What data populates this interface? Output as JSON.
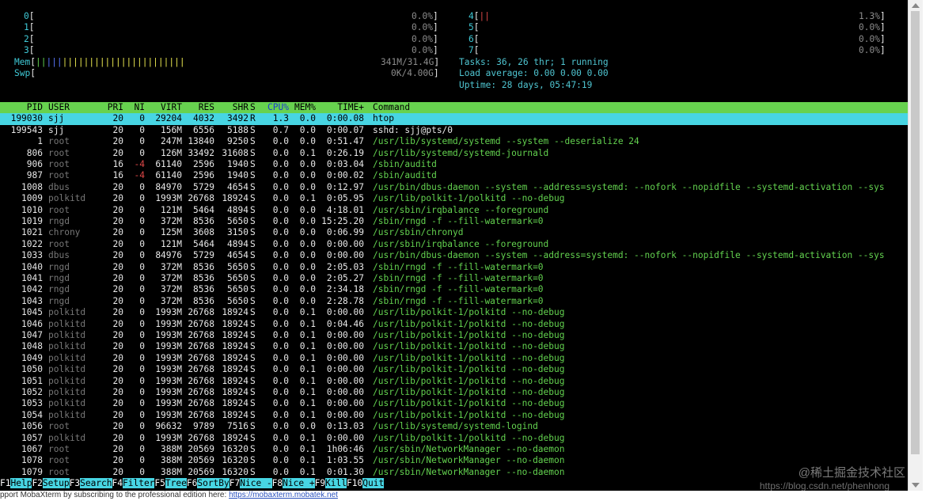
{
  "cpus": [
    {
      "id": "0",
      "pct": "0.0%"
    },
    {
      "id": "1",
      "pct": "0.0%"
    },
    {
      "id": "2",
      "pct": "0.0%"
    },
    {
      "id": "3",
      "pct": "0.0%"
    },
    {
      "id": "4",
      "pct": "1.3%"
    },
    {
      "id": "5",
      "pct": "0.0%"
    },
    {
      "id": "6",
      "pct": "0.0%"
    },
    {
      "id": "7",
      "pct": "0.0%"
    }
  ],
  "mem": {
    "label": "Mem",
    "value": "341M/31.4G"
  },
  "swp": {
    "label": "Swp",
    "value": "0K/4.00G"
  },
  "stats": {
    "tasks": "Tasks: 36, 26 thr; 1 running",
    "load": "Load average: 0.00 0.00 0.00",
    "uptime": "Uptime: 28 days, 05:47:19"
  },
  "columns": [
    "PID",
    "USER",
    "PRI",
    "NI",
    "VIRT",
    "RES",
    "SHR",
    "S",
    "CPU%",
    "MEM%",
    "TIME+",
    "Command"
  ],
  "processes": [
    [
      "199030",
      "sjj",
      "20",
      "0",
      "29204",
      "4032",
      "3492",
      "R",
      "1.3",
      "0.0",
      "0:00.08",
      "htop"
    ],
    [
      "199543",
      "sjj",
      "20",
      "0",
      "156M",
      "6556",
      "5188",
      "S",
      "0.7",
      "0.0",
      "0:00.07",
      "sshd: sjj@pts/0"
    ],
    [
      "1",
      "root",
      "20",
      "0",
      "247M",
      "13840",
      "9250",
      "S",
      "0.0",
      "0.0",
      "0:51.47",
      "/usr/lib/systemd/systemd --system --deserialize 24"
    ],
    [
      "806",
      "root",
      "20",
      "0",
      "126M",
      "33492",
      "31608",
      "S",
      "0.0",
      "0.1",
      "0:26.19",
      "/usr/lib/systemd/systemd-journald"
    ],
    [
      "906",
      "root",
      "16",
      "-4",
      "61140",
      "2596",
      "1940",
      "S",
      "0.0",
      "0.0",
      "0:03.04",
      "/sbin/auditd"
    ],
    [
      "987",
      "root",
      "16",
      "-4",
      "61140",
      "2596",
      "1940",
      "S",
      "0.0",
      "0.0",
      "0:00.02",
      "/sbin/auditd"
    ],
    [
      "1008",
      "dbus",
      "20",
      "0",
      "84970",
      "5729",
      "4654",
      "S",
      "0.0",
      "0.0",
      "0:12.97",
      "/usr/bin/dbus-daemon --system --address=systemd: --nofork --nopidfile --systemd-activation --sys"
    ],
    [
      "1009",
      "polkitd",
      "20",
      "0",
      "1993M",
      "26768",
      "18924",
      "S",
      "0.0",
      "0.1",
      "0:05.95",
      "/usr/lib/polkit-1/polkitd --no-debug"
    ],
    [
      "1010",
      "root",
      "20",
      "0",
      "121M",
      "5464",
      "4894",
      "S",
      "0.0",
      "0.0",
      "4:18.01",
      "/usr/sbin/irqbalance --foreground"
    ],
    [
      "1019",
      "rngd",
      "20",
      "0",
      "372M",
      "8536",
      "5650",
      "S",
      "0.0",
      "0.0",
      "15:25.20",
      "/sbin/rngd -f --fill-watermark=0"
    ],
    [
      "1021",
      "chrony",
      "20",
      "0",
      "125M",
      "3608",
      "3150",
      "S",
      "0.0",
      "0.0",
      "0:06.99",
      "/usr/sbin/chronyd"
    ],
    [
      "1022",
      "root",
      "20",
      "0",
      "121M",
      "5464",
      "4894",
      "S",
      "0.0",
      "0.0",
      "0:00.00",
      "/usr/sbin/irqbalance --foreground"
    ],
    [
      "1033",
      "dbus",
      "20",
      "0",
      "84976",
      "5729",
      "4654",
      "S",
      "0.0",
      "0.0",
      "0:00.00",
      "/usr/bin/dbus-daemon --system --address=systemd: --nofork --nopidfile --systemd-activation --sys"
    ],
    [
      "1040",
      "rngd",
      "20",
      "0",
      "372M",
      "8536",
      "5650",
      "S",
      "0.0",
      "0.0",
      "2:05.03",
      "/sbin/rngd -f --fill-watermark=0"
    ],
    [
      "1041",
      "rngd",
      "20",
      "0",
      "372M",
      "8536",
      "5650",
      "S",
      "0.0",
      "0.0",
      "2:05.27",
      "/sbin/rngd -f --fill-watermark=0"
    ],
    [
      "1042",
      "rngd",
      "20",
      "0",
      "372M",
      "8536",
      "5650",
      "S",
      "0.0",
      "0.0",
      "2:34.18",
      "/sbin/rngd -f --fill-watermark=0"
    ],
    [
      "1043",
      "rngd",
      "20",
      "0",
      "372M",
      "8536",
      "5650",
      "S",
      "0.0",
      "0.0",
      "2:28.78",
      "/sbin/rngd -f --fill-watermark=0"
    ],
    [
      "1045",
      "polkitd",
      "20",
      "0",
      "1993M",
      "26768",
      "18924",
      "S",
      "0.0",
      "0.1",
      "0:00.00",
      "/usr/lib/polkit-1/polkitd --no-debug"
    ],
    [
      "1046",
      "polkitd",
      "20",
      "0",
      "1993M",
      "26768",
      "18924",
      "S",
      "0.0",
      "0.1",
      "0:04.46",
      "/usr/lib/polkit-1/polkitd --no-debug"
    ],
    [
      "1047",
      "polkitd",
      "20",
      "0",
      "1993M",
      "26768",
      "18924",
      "S",
      "0.0",
      "0.1",
      "0:00.00",
      "/usr/lib/polkit-1/polkitd --no-debug"
    ],
    [
      "1048",
      "polkitd",
      "20",
      "0",
      "1993M",
      "26768",
      "18924",
      "S",
      "0.0",
      "0.1",
      "0:00.00",
      "/usr/lib/polkit-1/polkitd --no-debug"
    ],
    [
      "1049",
      "polkitd",
      "20",
      "0",
      "1993M",
      "26768",
      "18924",
      "S",
      "0.0",
      "0.1",
      "0:00.00",
      "/usr/lib/polkit-1/polkitd --no-debug"
    ],
    [
      "1050",
      "polkitd",
      "20",
      "0",
      "1993M",
      "26768",
      "18924",
      "S",
      "0.0",
      "0.1",
      "0:00.00",
      "/usr/lib/polkit-1/polkitd --no-debug"
    ],
    [
      "1051",
      "polkitd",
      "20",
      "0",
      "1993M",
      "26768",
      "18924",
      "S",
      "0.0",
      "0.1",
      "0:00.00",
      "/usr/lib/polkit-1/polkitd --no-debug"
    ],
    [
      "1052",
      "polkitd",
      "20",
      "0",
      "1993M",
      "26768",
      "18924",
      "S",
      "0.0",
      "0.1",
      "0:00.00",
      "/usr/lib/polkit-1/polkitd --no-debug"
    ],
    [
      "1053",
      "polkitd",
      "20",
      "0",
      "1993M",
      "26768",
      "18924",
      "S",
      "0.0",
      "0.1",
      "0:00.00",
      "/usr/lib/polkit-1/polkitd --no-debug"
    ],
    [
      "1054",
      "polkitd",
      "20",
      "0",
      "1993M",
      "26768",
      "18924",
      "S",
      "0.0",
      "0.1",
      "0:00.00",
      "/usr/lib/polkit-1/polkitd --no-debug"
    ],
    [
      "1056",
      "root",
      "20",
      "0",
      "96632",
      "9789",
      "7516",
      "S",
      "0.0",
      "0.0",
      "0:13.03",
      "/usr/lib/systemd/systemd-logind"
    ],
    [
      "1057",
      "polkitd",
      "20",
      "0",
      "1993M",
      "26768",
      "18924",
      "S",
      "0.0",
      "0.1",
      "0:00.00",
      "/usr/lib/polkit-1/polkitd --no-debug"
    ],
    [
      "1067",
      "root",
      "20",
      "0",
      "388M",
      "20569",
      "16320",
      "S",
      "0.0",
      "0.1",
      "1h06:46",
      "/usr/sbin/NetworkManager --no-daemon"
    ],
    [
      "1078",
      "root",
      "20",
      "0",
      "388M",
      "20569",
      "16320",
      "S",
      "0.0",
      "0.1",
      "1:03.55",
      "/usr/sbin/NetworkManager --no-daemon"
    ],
    [
      "1079",
      "root",
      "20",
      "0",
      "388M",
      "20569",
      "16320",
      "S",
      "0.0",
      "0.1",
      "0:01.30",
      "/usr/sbin/NetworkManager --no-daemon"
    ]
  ],
  "fkeys": [
    {
      "key": "F1",
      "label": "Help"
    },
    {
      "key": "F2",
      "label": "Setup"
    },
    {
      "key": "F3",
      "label": "Search"
    },
    {
      "key": "F4",
      "label": "Filter"
    },
    {
      "key": "F5",
      "label": "Tree"
    },
    {
      "key": "F6",
      "label": "SortBy"
    },
    {
      "key": "F7",
      "label": "Nice -"
    },
    {
      "key": "F8",
      "label": "Nice +"
    },
    {
      "key": "F9",
      "label": "Kill"
    },
    {
      "key": "F10",
      "label": "Quit"
    }
  ],
  "banner": {
    "text": "pport MobaXterm by subscribing to the professional edition here:",
    "link": "https://mobaxterm.mobatek.net"
  },
  "watermark": {
    "main": "@稀土掘金技术社区",
    "sub": "https://blog.csdn.net/phenhong"
  }
}
